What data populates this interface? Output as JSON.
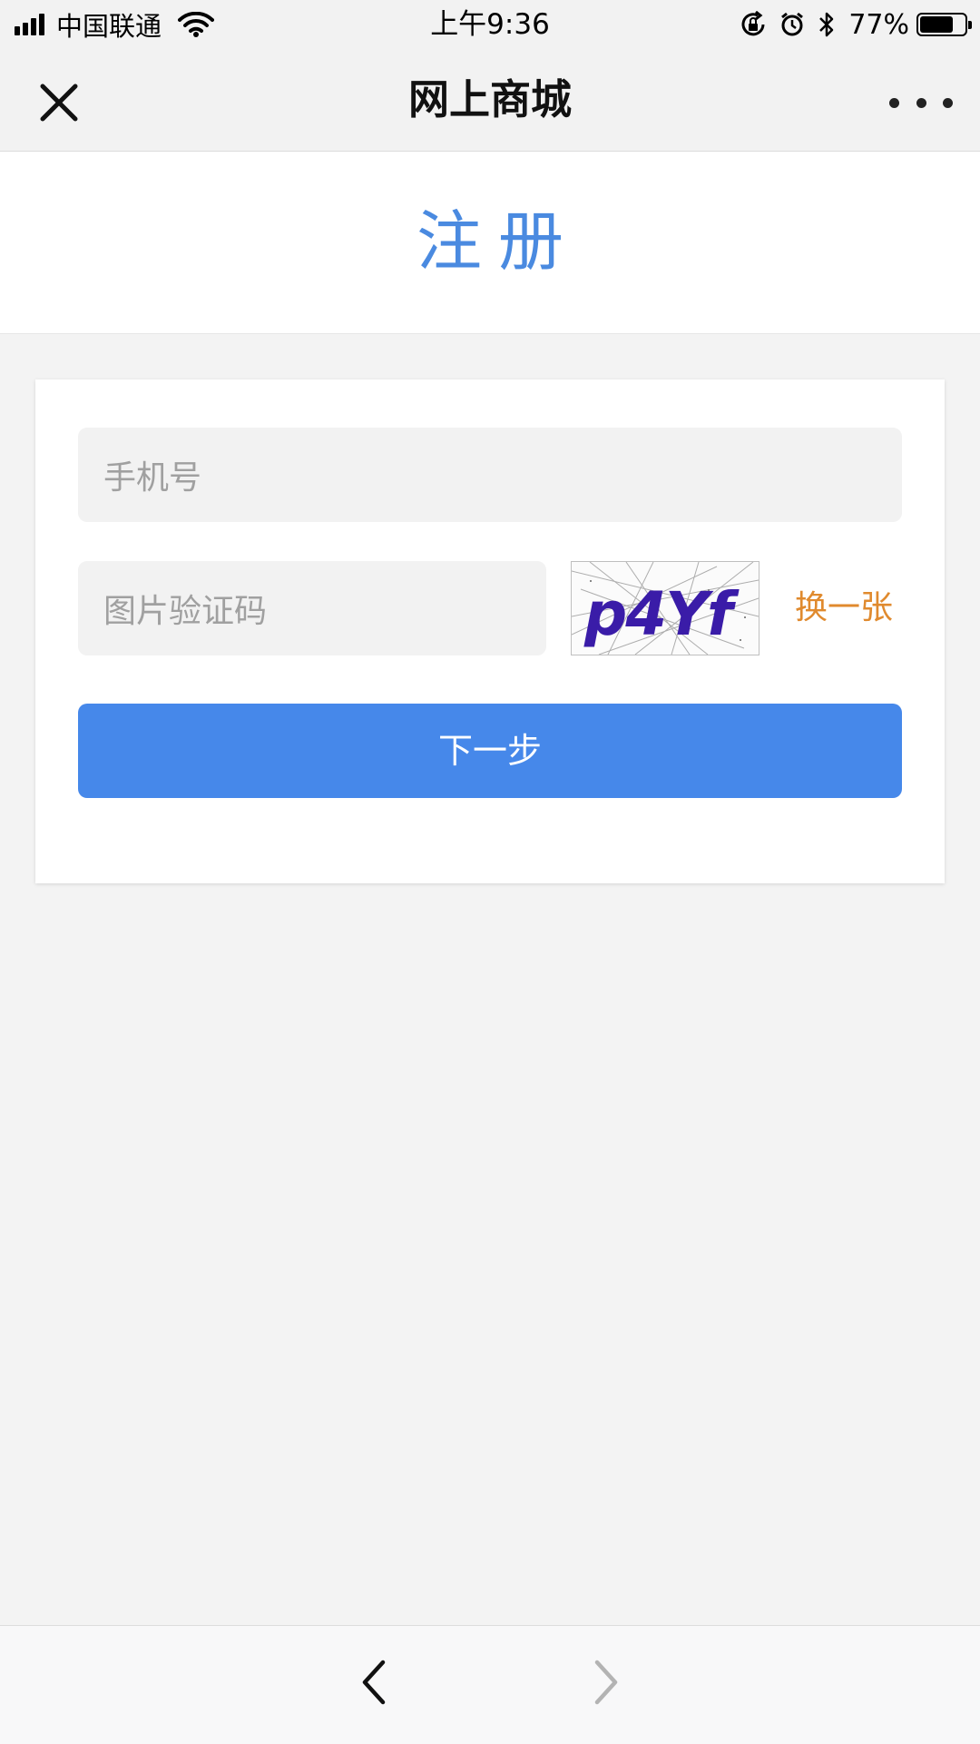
{
  "status_bar": {
    "carrier": "中国联通",
    "time": "上午9:36",
    "battery_percent": "77%",
    "battery_level": 0.77,
    "icons": [
      "signal-icon",
      "wifi-icon",
      "rotation-lock-icon",
      "alarm-icon",
      "bluetooth-icon",
      "battery-icon"
    ]
  },
  "nav": {
    "title": "网上商城",
    "close_icon": "close-icon",
    "more_icon": "more-icon"
  },
  "page": {
    "title": "注册"
  },
  "form": {
    "phone_placeholder": "手机号",
    "captcha_placeholder": "图片验证码",
    "captcha_text": "p4Yf",
    "refresh_label": "换一张",
    "next_label": "下一步"
  },
  "bottom_bar": {
    "back_icon": "chevron-left-icon",
    "forward_icon": "chevron-right-icon"
  },
  "colors": {
    "accent": "#4688ea",
    "title": "#4a8ae0",
    "link": "#e08a2e",
    "background": "#f3f3f3"
  }
}
